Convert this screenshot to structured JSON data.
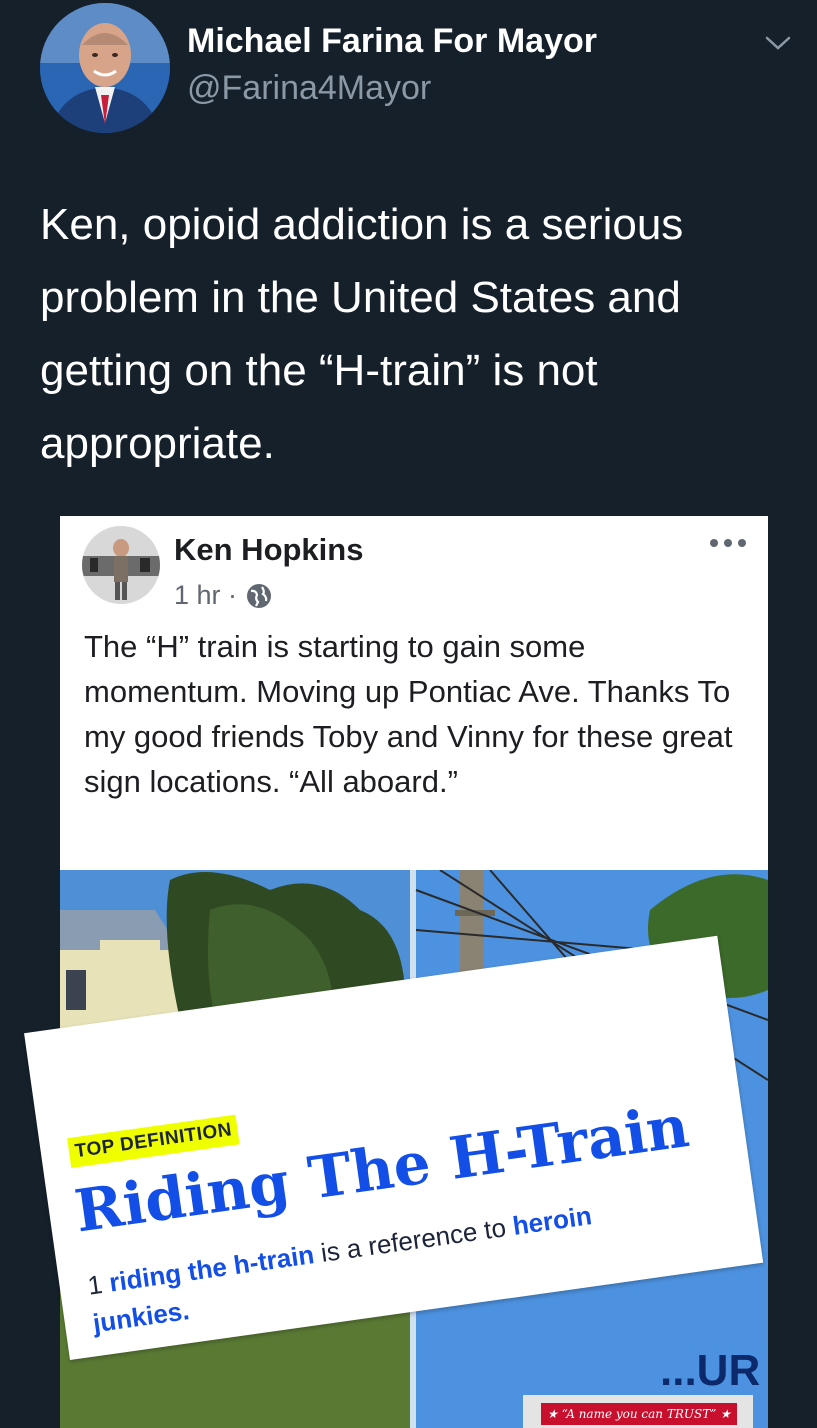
{
  "tweet": {
    "author_name": "Michael Farina For Mayor",
    "author_handle": "@Farina4Mayor",
    "text": "Ken, opioid addiction is a serious problem in the United States and getting on the “H-train” is not appropriate.",
    "menu_icon": "chevron-down-icon"
  },
  "embedded_post": {
    "author_name": "Ken Hopkins",
    "time": "1 hr ·",
    "privacy_icon": "globe-icon",
    "more_icon": "ellipsis-icon",
    "text": "The “H” train is starting to gain some momentum. Moving up Pontiac Ave. Thanks To my good friends Toby and Vinny for these great sign locations. “All aboard.”"
  },
  "definition": {
    "badge": "TOP DEFINITION",
    "title": "Riding The H-Train",
    "number": "1",
    "term": "riding the h-train",
    "middle": " is a reference to ",
    "keyword": "heroin",
    "ending": "junkies."
  },
  "sign": {
    "letters": "...UR",
    "slogan": "★ “A name you can TRUST” ★"
  },
  "colors": {
    "background": "#15202b",
    "link_blue": "#134fe6",
    "highlight": "#efff00"
  }
}
